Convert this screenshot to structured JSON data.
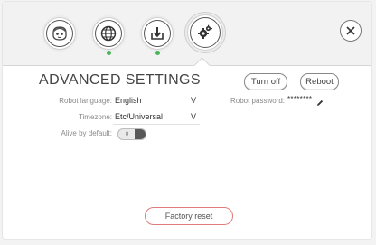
{
  "nav": {
    "items": [
      {
        "icon": "robot-face-icon",
        "indicator": false
      },
      {
        "icon": "globe-icon",
        "indicator": true
      },
      {
        "icon": "download-icon",
        "indicator": true
      },
      {
        "icon": "gears-icon",
        "indicator": false,
        "active": true
      }
    ],
    "indicator_color": "#49b35b"
  },
  "close": {
    "icon": "close-icon"
  },
  "page": {
    "title": "ADVANCED SETTINGS"
  },
  "actions": {
    "turn_off_label": "Turn off",
    "reboot_label": "Reboot"
  },
  "settings": {
    "robot_language": {
      "label": "Robot language:",
      "value": "English"
    },
    "timezone": {
      "label": "Timezone:",
      "value": "Etc/Universal"
    },
    "alive_by_default": {
      "label": "Alive by default:",
      "toggle_text": "0",
      "on": false
    },
    "robot_password": {
      "label": "Robot password:",
      "value": "********",
      "edit_icon": "pencil-icon"
    }
  },
  "factory_reset": {
    "label": "Factory reset",
    "color": "#e07b7b"
  }
}
